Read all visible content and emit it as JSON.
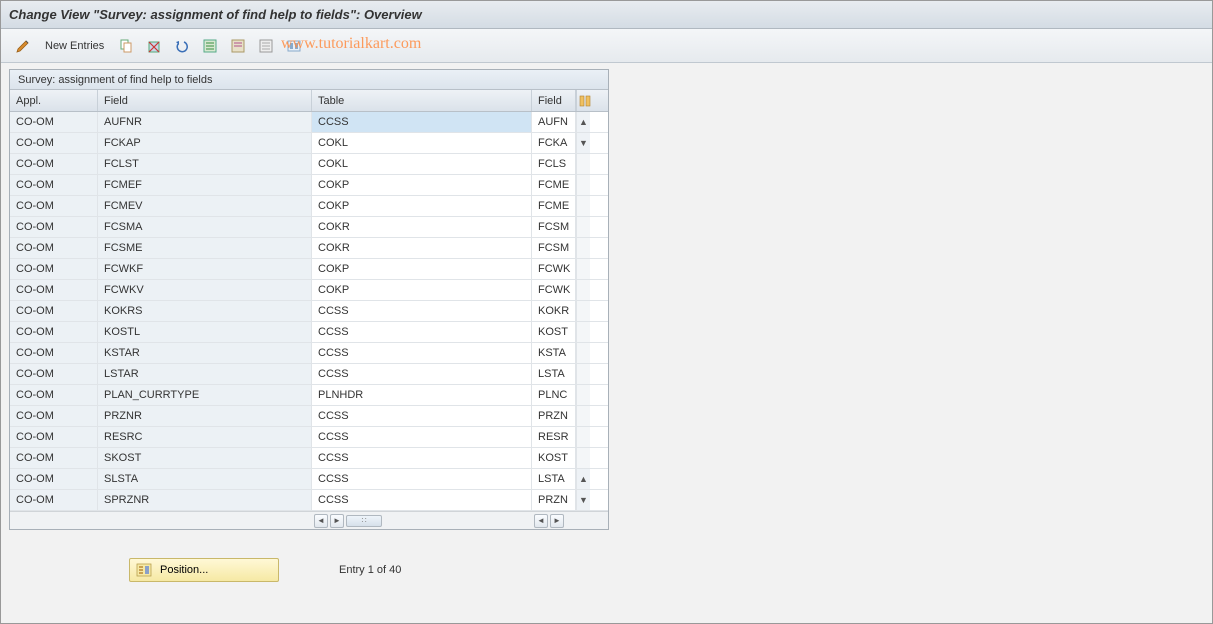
{
  "title": "Change View \"Survey: assignment of find help to fields\": Overview",
  "toolbar": {
    "new_entries": "New Entries"
  },
  "watermark": "www.tutorialkart.com",
  "panel": {
    "title": "Survey: assignment of find help to fields"
  },
  "columns": {
    "appl": "Appl.",
    "field": "Field",
    "table": "Table",
    "field2": "Field"
  },
  "rows": [
    {
      "appl": "CO-OM",
      "field": "AUFNR",
      "table": "CCSS",
      "field2": "AUFN"
    },
    {
      "appl": "CO-OM",
      "field": "FCKAP",
      "table": "COKL",
      "field2": "FCKA"
    },
    {
      "appl": "CO-OM",
      "field": "FCLST",
      "table": "COKL",
      "field2": "FCLS"
    },
    {
      "appl": "CO-OM",
      "field": "FCMEF",
      "table": "COKP",
      "field2": "FCME"
    },
    {
      "appl": "CO-OM",
      "field": "FCMEV",
      "table": "COKP",
      "field2": "FCME"
    },
    {
      "appl": "CO-OM",
      "field": "FCSMA",
      "table": "COKR",
      "field2": "FCSM"
    },
    {
      "appl": "CO-OM",
      "field": "FCSME",
      "table": "COKR",
      "field2": "FCSM"
    },
    {
      "appl": "CO-OM",
      "field": "FCWKF",
      "table": "COKP",
      "field2": "FCWK"
    },
    {
      "appl": "CO-OM",
      "field": "FCWKV",
      "table": "COKP",
      "field2": "FCWK"
    },
    {
      "appl": "CO-OM",
      "field": "KOKRS",
      "table": "CCSS",
      "field2": "KOKR"
    },
    {
      "appl": "CO-OM",
      "field": "KOSTL",
      "table": "CCSS",
      "field2": "KOST"
    },
    {
      "appl": "CO-OM",
      "field": "KSTAR",
      "table": "CCSS",
      "field2": "KSTA"
    },
    {
      "appl": "CO-OM",
      "field": "LSTAR",
      "table": "CCSS",
      "field2": "LSTA"
    },
    {
      "appl": "CO-OM",
      "field": "PLAN_CURRTYPE",
      "table": "PLNHDR",
      "field2": "PLNC"
    },
    {
      "appl": "CO-OM",
      "field": "PRZNR",
      "table": "CCSS",
      "field2": "PRZN"
    },
    {
      "appl": "CO-OM",
      "field": "RESRC",
      "table": "CCSS",
      "field2": "RESR"
    },
    {
      "appl": "CO-OM",
      "field": "SKOST",
      "table": "CCSS",
      "field2": "KOST"
    },
    {
      "appl": "CO-OM",
      "field": "SLSTA",
      "table": "CCSS",
      "field2": "LSTA"
    },
    {
      "appl": "CO-OM",
      "field": "SPRZNR",
      "table": "CCSS",
      "field2": "PRZN"
    }
  ],
  "footer": {
    "position_label": "Position...",
    "entry_label": "Entry 1 of 40"
  }
}
